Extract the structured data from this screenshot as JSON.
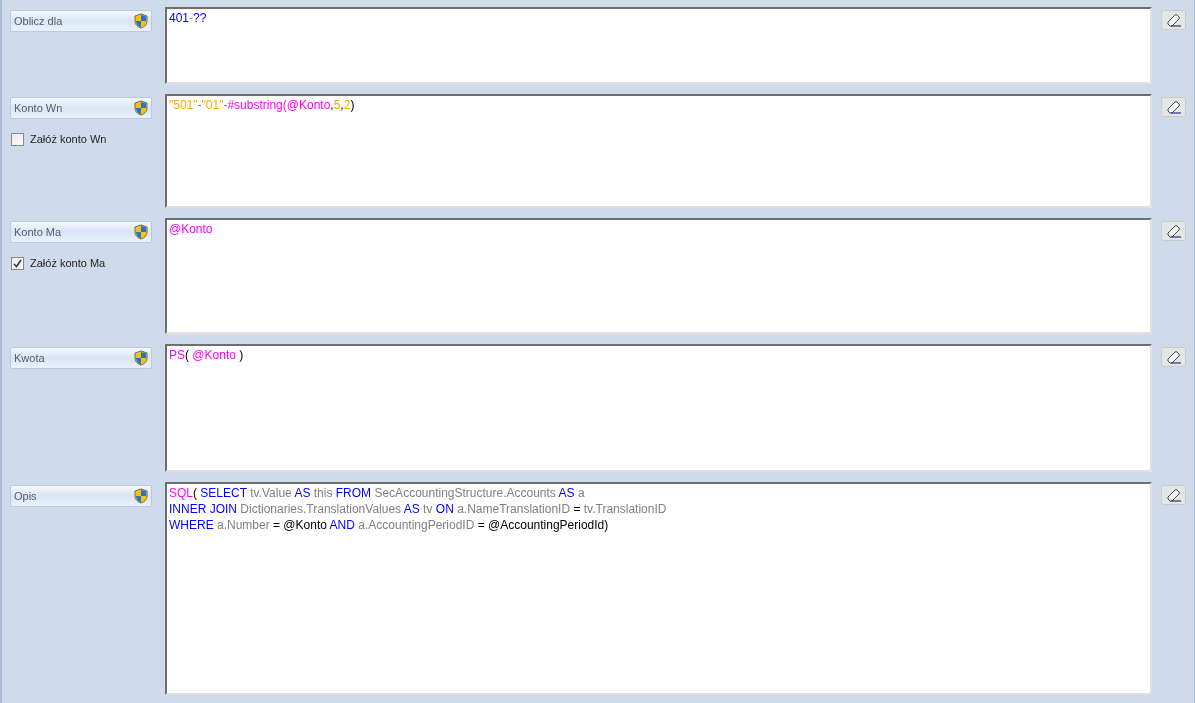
{
  "fields": [
    {
      "label": "Oblicz dla",
      "lines": [
        [
          {
            "text": "401",
            "kind": "keyword"
          },
          {
            "text": "-",
            "kind": "identifier"
          },
          {
            "text": "??",
            "kind": "keyword"
          }
        ]
      ]
    },
    {
      "label": "Konto Wn",
      "checkbox": {
        "label": "Załóż konto Wn",
        "checked": false
      },
      "lines": [
        [
          {
            "text": "\"501\"",
            "kind": "literal"
          },
          {
            "text": "-",
            "kind": "identifier"
          },
          {
            "text": "\"01\"",
            "kind": "literal"
          },
          {
            "text": "-",
            "kind": "identifier"
          },
          {
            "text": "#substring(@Konto",
            "kind": "function"
          },
          {
            "text": ",",
            "kind": "operator"
          },
          {
            "text": "5",
            "kind": "literal"
          },
          {
            "text": ",",
            "kind": "operator"
          },
          {
            "text": "2",
            "kind": "literal"
          },
          {
            "text": ")",
            "kind": "operator"
          }
        ]
      ]
    },
    {
      "label": "Konto Ma",
      "checkbox": {
        "label": "Załóż konto Ma",
        "checked": true
      },
      "lines": [
        [
          {
            "text": "@Konto",
            "kind": "function"
          }
        ]
      ]
    },
    {
      "label": "Kwota",
      "lines": [
        [
          {
            "text": "PS",
            "kind": "function"
          },
          {
            "text": "( ",
            "kind": "operator"
          },
          {
            "text": "@Konto",
            "kind": "function"
          },
          {
            "text": " )",
            "kind": "operator"
          }
        ]
      ]
    },
    {
      "label": "Opis",
      "lines": [
        [
          {
            "text": "SQL",
            "kind": "function"
          },
          {
            "text": "( ",
            "kind": "operator"
          },
          {
            "text": "SELECT",
            "kind": "keyword"
          },
          {
            "text": " tv.Value ",
            "kind": "identifier"
          },
          {
            "text": "AS",
            "kind": "keyword"
          },
          {
            "text": " this ",
            "kind": "identifier"
          },
          {
            "text": "FROM",
            "kind": "keyword"
          },
          {
            "text": " SecAccountingStructure.Accounts ",
            "kind": "identifier"
          },
          {
            "text": "AS",
            "kind": "keyword"
          },
          {
            "text": " a",
            "kind": "identifier"
          }
        ],
        [
          {
            "text": "INNER JOIN",
            "kind": "keyword"
          },
          {
            "text": " Dictionaries.TranslationValues ",
            "kind": "identifier"
          },
          {
            "text": "AS",
            "kind": "keyword"
          },
          {
            "text": " tv ",
            "kind": "identifier"
          },
          {
            "text": "ON",
            "kind": "keyword"
          },
          {
            "text": " a.NameTranslationID ",
            "kind": "identifier"
          },
          {
            "text": "= ",
            "kind": "operator"
          },
          {
            "text": "tv.TranslationID",
            "kind": "identifier"
          }
        ],
        [
          {
            "text": "WHERE",
            "kind": "keyword"
          },
          {
            "text": " a.Number ",
            "kind": "identifier"
          },
          {
            "text": "= @Konto ",
            "kind": "operator"
          },
          {
            "text": "AND",
            "kind": "keyword"
          },
          {
            "text": " a.AccountingPeriodID ",
            "kind": "identifier"
          },
          {
            "text": "= @AccountingPeriodId)",
            "kind": "operator"
          }
        ]
      ]
    }
  ]
}
